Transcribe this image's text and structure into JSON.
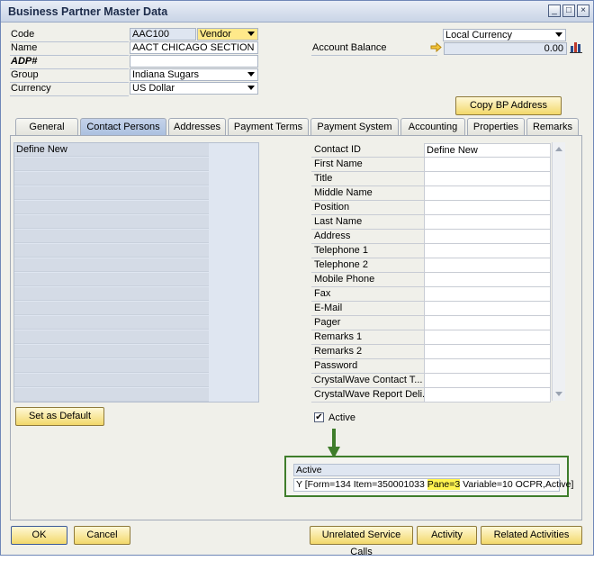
{
  "window": {
    "title": "Business Partner Master Data",
    "controls": [
      "_",
      "□",
      "×"
    ]
  },
  "header": {
    "code_label": "Code",
    "code_value": "AAC100",
    "bp_type": "Vendor",
    "name_label": "Name",
    "name_value": "AACT CHICAGO SECTION",
    "adp_label": "ADP#",
    "adp_value": "",
    "group_label": "Group",
    "group_value": "Indiana Sugars",
    "currency_label": "Currency",
    "currency_value": "US Dollar",
    "currency_mode": "Local Currency",
    "balance_label": "Account Balance",
    "balance_value": "0.00",
    "copy_button": "Copy BP Address"
  },
  "tabs": [
    {
      "label": "General"
    },
    {
      "label": "Contact Persons"
    },
    {
      "label": "Addresses"
    },
    {
      "label": "Payment Terms"
    },
    {
      "label": "Payment System"
    },
    {
      "label": "Accounting"
    },
    {
      "label": "Properties"
    },
    {
      "label": "Remarks"
    }
  ],
  "contacts": {
    "list_first": "Define New",
    "set_default": "Set as Default"
  },
  "details": {
    "fields": [
      {
        "label": "Contact ID",
        "value": "Define New"
      },
      {
        "label": "First Name",
        "value": ""
      },
      {
        "label": "Title",
        "value": ""
      },
      {
        "label": "Middle Name",
        "value": ""
      },
      {
        "label": "Position",
        "value": ""
      },
      {
        "label": "Last Name",
        "value": ""
      },
      {
        "label": "Address",
        "value": ""
      },
      {
        "label": "Telephone 1",
        "value": ""
      },
      {
        "label": "Telephone 2",
        "value": ""
      },
      {
        "label": "Mobile Phone",
        "value": ""
      },
      {
        "label": "Fax",
        "value": ""
      },
      {
        "label": "E-Mail",
        "value": ""
      },
      {
        "label": "Pager",
        "value": ""
      },
      {
        "label": "Remarks 1",
        "value": ""
      },
      {
        "label": "Remarks 2",
        "value": ""
      },
      {
        "label": "Password",
        "value": ""
      },
      {
        "label": "CrystalWave Contact T...",
        "value": ""
      },
      {
        "label": "CrystalWave Report Deli...",
        "value": ""
      }
    ],
    "active_label": "Active",
    "active_checked": "✔"
  },
  "debug": {
    "title": "Active",
    "line_pre": "Y [Form=134 Item=350001033 ",
    "line_hl": "Pane=3",
    "line_post": " Variable=10 OCPR,Active]"
  },
  "footer": {
    "ok": "OK",
    "cancel": "Cancel",
    "unrelated": "Unrelated Service Calls",
    "activity": "Activity",
    "related": "Related Activities"
  }
}
